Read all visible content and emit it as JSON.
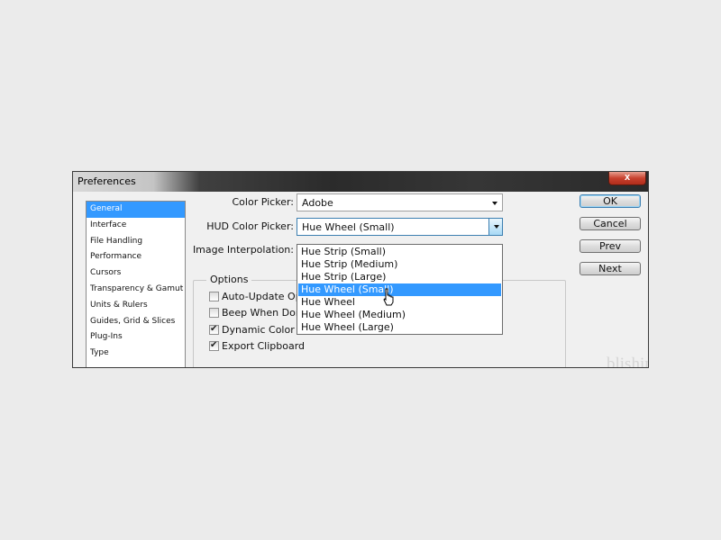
{
  "window": {
    "title": "Preferences",
    "close_glyph": "x"
  },
  "sidebar": {
    "items": [
      {
        "label": "General",
        "selected": true
      },
      {
        "label": "Interface"
      },
      {
        "label": "File Handling"
      },
      {
        "label": "Performance"
      },
      {
        "label": "Cursors"
      },
      {
        "label": "Transparency & Gamut"
      },
      {
        "label": "Units & Rulers"
      },
      {
        "label": "Guides, Grid & Slices"
      },
      {
        "label": "Plug-Ins"
      },
      {
        "label": "Type"
      }
    ]
  },
  "form": {
    "color_picker_label": "Color Picker:",
    "color_picker_value": "Adobe",
    "hud_label": "HUD Color Picker:",
    "hud_value": "Hue Wheel (Small)",
    "interp_label": "Image Interpolation:"
  },
  "options": {
    "legend": "Options",
    "checkboxes": [
      {
        "label": "Auto-Update Ope",
        "checked": false
      },
      {
        "label": "Beep When Done",
        "checked": false
      },
      {
        "label": "Dynamic Color Sliders",
        "checked": true
      },
      {
        "label": "Export Clipboard",
        "checked": true
      }
    ],
    "check_glyph": "✔"
  },
  "dropdown": {
    "options": [
      "Hue Strip (Small)",
      "Hue Strip (Medium)",
      "Hue Strip (Large)",
      "Hue Wheel (Small)",
      "Hue Wheel",
      "Hue Wheel (Medium)",
      "Hue Wheel (Large)"
    ],
    "highlighted_index": 3
  },
  "buttons": {
    "ok": "OK",
    "cancel": "Cancel",
    "prev": "Prev",
    "next": "Next"
  },
  "watermark": "blishing",
  "colors": {
    "selection": "#3399ff",
    "dialog_bg": "#f0f0f0"
  }
}
